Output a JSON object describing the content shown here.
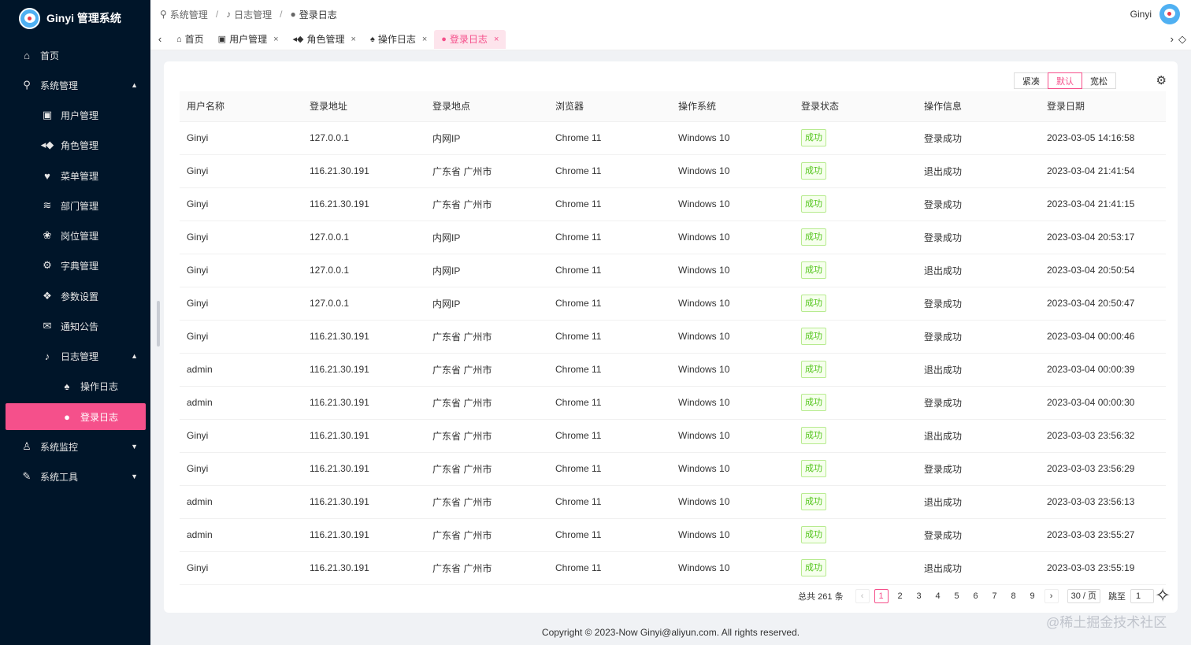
{
  "app": {
    "title": "Ginyi 管理系统"
  },
  "sidebar": {
    "items": [
      {
        "label": "首页",
        "icon": "home-icon"
      },
      {
        "label": "系统管理",
        "icon": "person-icon"
      },
      {
        "label": "用户管理",
        "icon": "user-square-icon"
      },
      {
        "label": "角色管理",
        "icon": "role-icon"
      },
      {
        "label": "菜单管理",
        "icon": "heart-icon"
      },
      {
        "label": "部门管理",
        "icon": "layers-icon"
      },
      {
        "label": "岗位管理",
        "icon": "paw-icon"
      },
      {
        "label": "字典管理",
        "icon": "dictionary-icon"
      },
      {
        "label": "参数设置",
        "icon": "chat-icon"
      },
      {
        "label": "通知公告",
        "icon": "mail-icon"
      },
      {
        "label": "日志管理",
        "icon": "microphone-icon"
      },
      {
        "label": "操作日志",
        "icon": "bell-icon"
      },
      {
        "label": "登录日志",
        "icon": "planet-icon"
      },
      {
        "label": "系统监控",
        "icon": "monitor-user-icon"
      },
      {
        "label": "系统工具",
        "icon": "wrench-icon"
      }
    ]
  },
  "breadcrumb": [
    "系统管理",
    "日志管理",
    "登录日志"
  ],
  "user": {
    "name": "Ginyi"
  },
  "tabs": [
    {
      "label": "首页"
    },
    {
      "label": "用户管理"
    },
    {
      "label": "角色管理"
    },
    {
      "label": "操作日志"
    },
    {
      "label": "登录日志"
    }
  ],
  "density": [
    "紧凑",
    "默认",
    "宽松"
  ],
  "table": {
    "columns": [
      "用户名称",
      "登录地址",
      "登录地点",
      "浏览器",
      "操作系统",
      "登录状态",
      "操作信息",
      "登录日期"
    ],
    "rows": [
      [
        "Ginyi",
        "127.0.0.1",
        "内网IP",
        "Chrome 11",
        "Windows 10",
        "成功",
        "登录成功",
        "2023-03-05 14:16:58"
      ],
      [
        "Ginyi",
        "116.21.30.191",
        "广东省 广州市",
        "Chrome 11",
        "Windows 10",
        "成功",
        "退出成功",
        "2023-03-04 21:41:54"
      ],
      [
        "Ginyi",
        "116.21.30.191",
        "广东省 广州市",
        "Chrome 11",
        "Windows 10",
        "成功",
        "登录成功",
        "2023-03-04 21:41:15"
      ],
      [
        "Ginyi",
        "127.0.0.1",
        "内网IP",
        "Chrome 11",
        "Windows 10",
        "成功",
        "登录成功",
        "2023-03-04 20:53:17"
      ],
      [
        "Ginyi",
        "127.0.0.1",
        "内网IP",
        "Chrome 11",
        "Windows 10",
        "成功",
        "退出成功",
        "2023-03-04 20:50:54"
      ],
      [
        "Ginyi",
        "127.0.0.1",
        "内网IP",
        "Chrome 11",
        "Windows 10",
        "成功",
        "登录成功",
        "2023-03-04 20:50:47"
      ],
      [
        "Ginyi",
        "116.21.30.191",
        "广东省 广州市",
        "Chrome 11",
        "Windows 10",
        "成功",
        "登录成功",
        "2023-03-04 00:00:46"
      ],
      [
        "admin",
        "116.21.30.191",
        "广东省 广州市",
        "Chrome 11",
        "Windows 10",
        "成功",
        "退出成功",
        "2023-03-04 00:00:39"
      ],
      [
        "admin",
        "116.21.30.191",
        "广东省 广州市",
        "Chrome 11",
        "Windows 10",
        "成功",
        "登录成功",
        "2023-03-04 00:00:30"
      ],
      [
        "Ginyi",
        "116.21.30.191",
        "广东省 广州市",
        "Chrome 11",
        "Windows 10",
        "成功",
        "退出成功",
        "2023-03-03 23:56:32"
      ],
      [
        "Ginyi",
        "116.21.30.191",
        "广东省 广州市",
        "Chrome 11",
        "Windows 10",
        "成功",
        "登录成功",
        "2023-03-03 23:56:29"
      ],
      [
        "admin",
        "116.21.30.191",
        "广东省 广州市",
        "Chrome 11",
        "Windows 10",
        "成功",
        "退出成功",
        "2023-03-03 23:56:13"
      ],
      [
        "admin",
        "116.21.30.191",
        "广东省 广州市",
        "Chrome 11",
        "Windows 10",
        "成功",
        "登录成功",
        "2023-03-03 23:55:27"
      ],
      [
        "Ginyi",
        "116.21.30.191",
        "广东省 广州市",
        "Chrome 11",
        "Windows 10",
        "成功",
        "退出成功",
        "2023-03-03 23:55:19"
      ]
    ]
  },
  "pagination": {
    "total": "总共 261 条",
    "pages": [
      "1",
      "2",
      "3",
      "4",
      "5",
      "6",
      "7",
      "8",
      "9"
    ],
    "current": "1",
    "page_size": "30 / 页",
    "jump_label": "跳至",
    "jump_value": "1"
  },
  "footer": {
    "text": "Copyright © 2023-Now Ginyi@aliyun.com. All rights reserved."
  },
  "watermark": "@稀土掘金技术社区",
  "colors": {
    "sidebar_bg": "#001529",
    "accent": "#f5508b",
    "success": "#52c41a"
  }
}
